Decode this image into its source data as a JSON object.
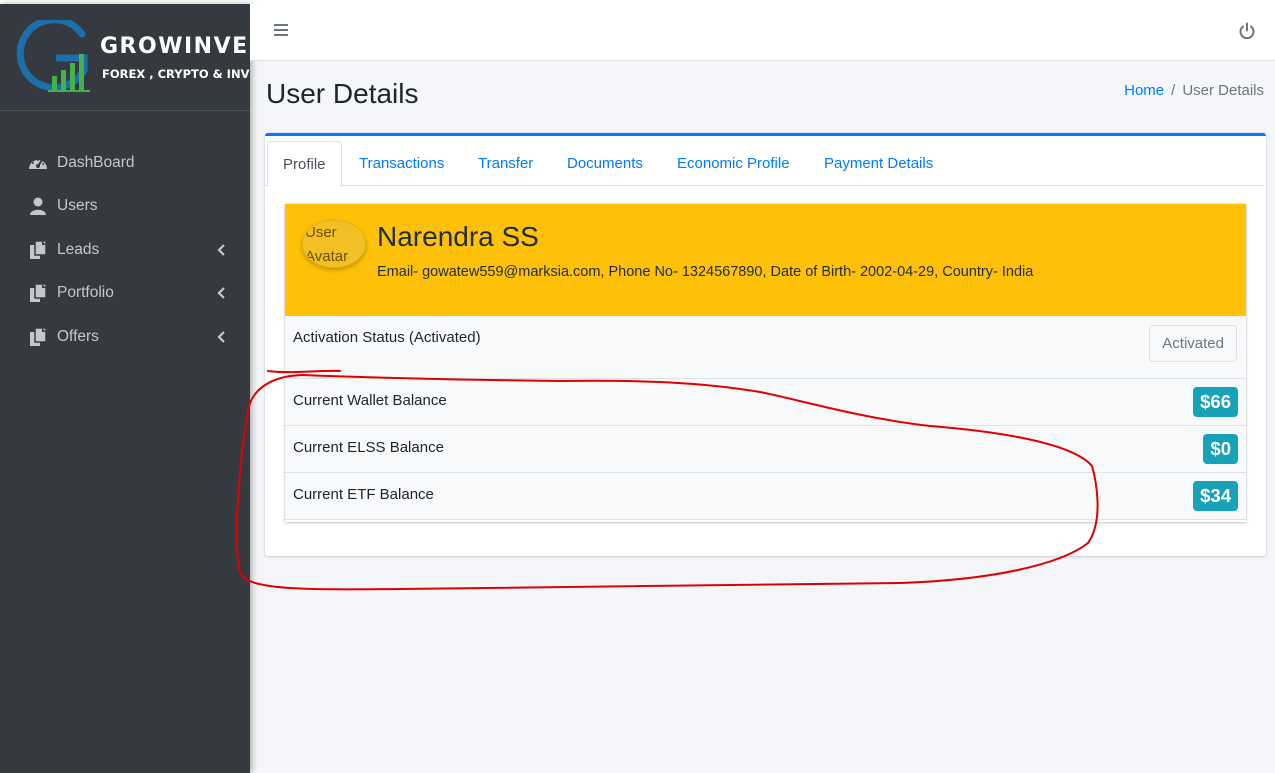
{
  "brand": {
    "title": "GROWINVE",
    "subtitle": "FOREX , CRYPTO & INV",
    "logo_icon": "growinvest-logo-icon"
  },
  "sidebar": {
    "items": [
      {
        "label": "DashBoard",
        "icon": "dashboard-gauge-icon",
        "has_submenu": false
      },
      {
        "label": "Users",
        "icon": "user-icon",
        "has_submenu": false
      },
      {
        "label": "Leads",
        "icon": "copy-icon",
        "has_submenu": true
      },
      {
        "label": "Portfolio",
        "icon": "copy-icon",
        "has_submenu": true
      },
      {
        "label": "Offers",
        "icon": "copy-icon",
        "has_submenu": true
      }
    ]
  },
  "topnav": {
    "menu_icon": "hamburger-icon",
    "power_icon": "power-icon"
  },
  "page": {
    "title": "User Details",
    "breadcrumb": {
      "home": "Home",
      "separator": "/",
      "current": "User Details"
    }
  },
  "tabs": [
    {
      "label": "Profile",
      "active": true
    },
    {
      "label": "Transactions",
      "active": false
    },
    {
      "label": "Transfer",
      "active": false
    },
    {
      "label": "Documents",
      "active": false
    },
    {
      "label": "Economic Profile",
      "active": false
    },
    {
      "label": "Payment Details",
      "active": false
    }
  ],
  "profile": {
    "avatar_alt": "User Avatar",
    "name": "Narendra SS",
    "details": "Email- gowatew559@marksia.com, Phone No- 1324567890, Date of Birth- 2002-04-29, Country- India",
    "header_color": "#ffc107"
  },
  "status": {
    "label": "Activation Status (Activated)",
    "button": "Activated"
  },
  "balances": [
    {
      "label": "Current Wallet Balance",
      "value": "$66"
    },
    {
      "label": "Current ELSS Balance",
      "value": "$0"
    },
    {
      "label": "Current ETF Balance",
      "value": "$34"
    }
  ],
  "colors": {
    "sidebar": "#343a40",
    "accent": "#007bff",
    "badge": "#17a2b8",
    "annotation": "#e00000"
  }
}
